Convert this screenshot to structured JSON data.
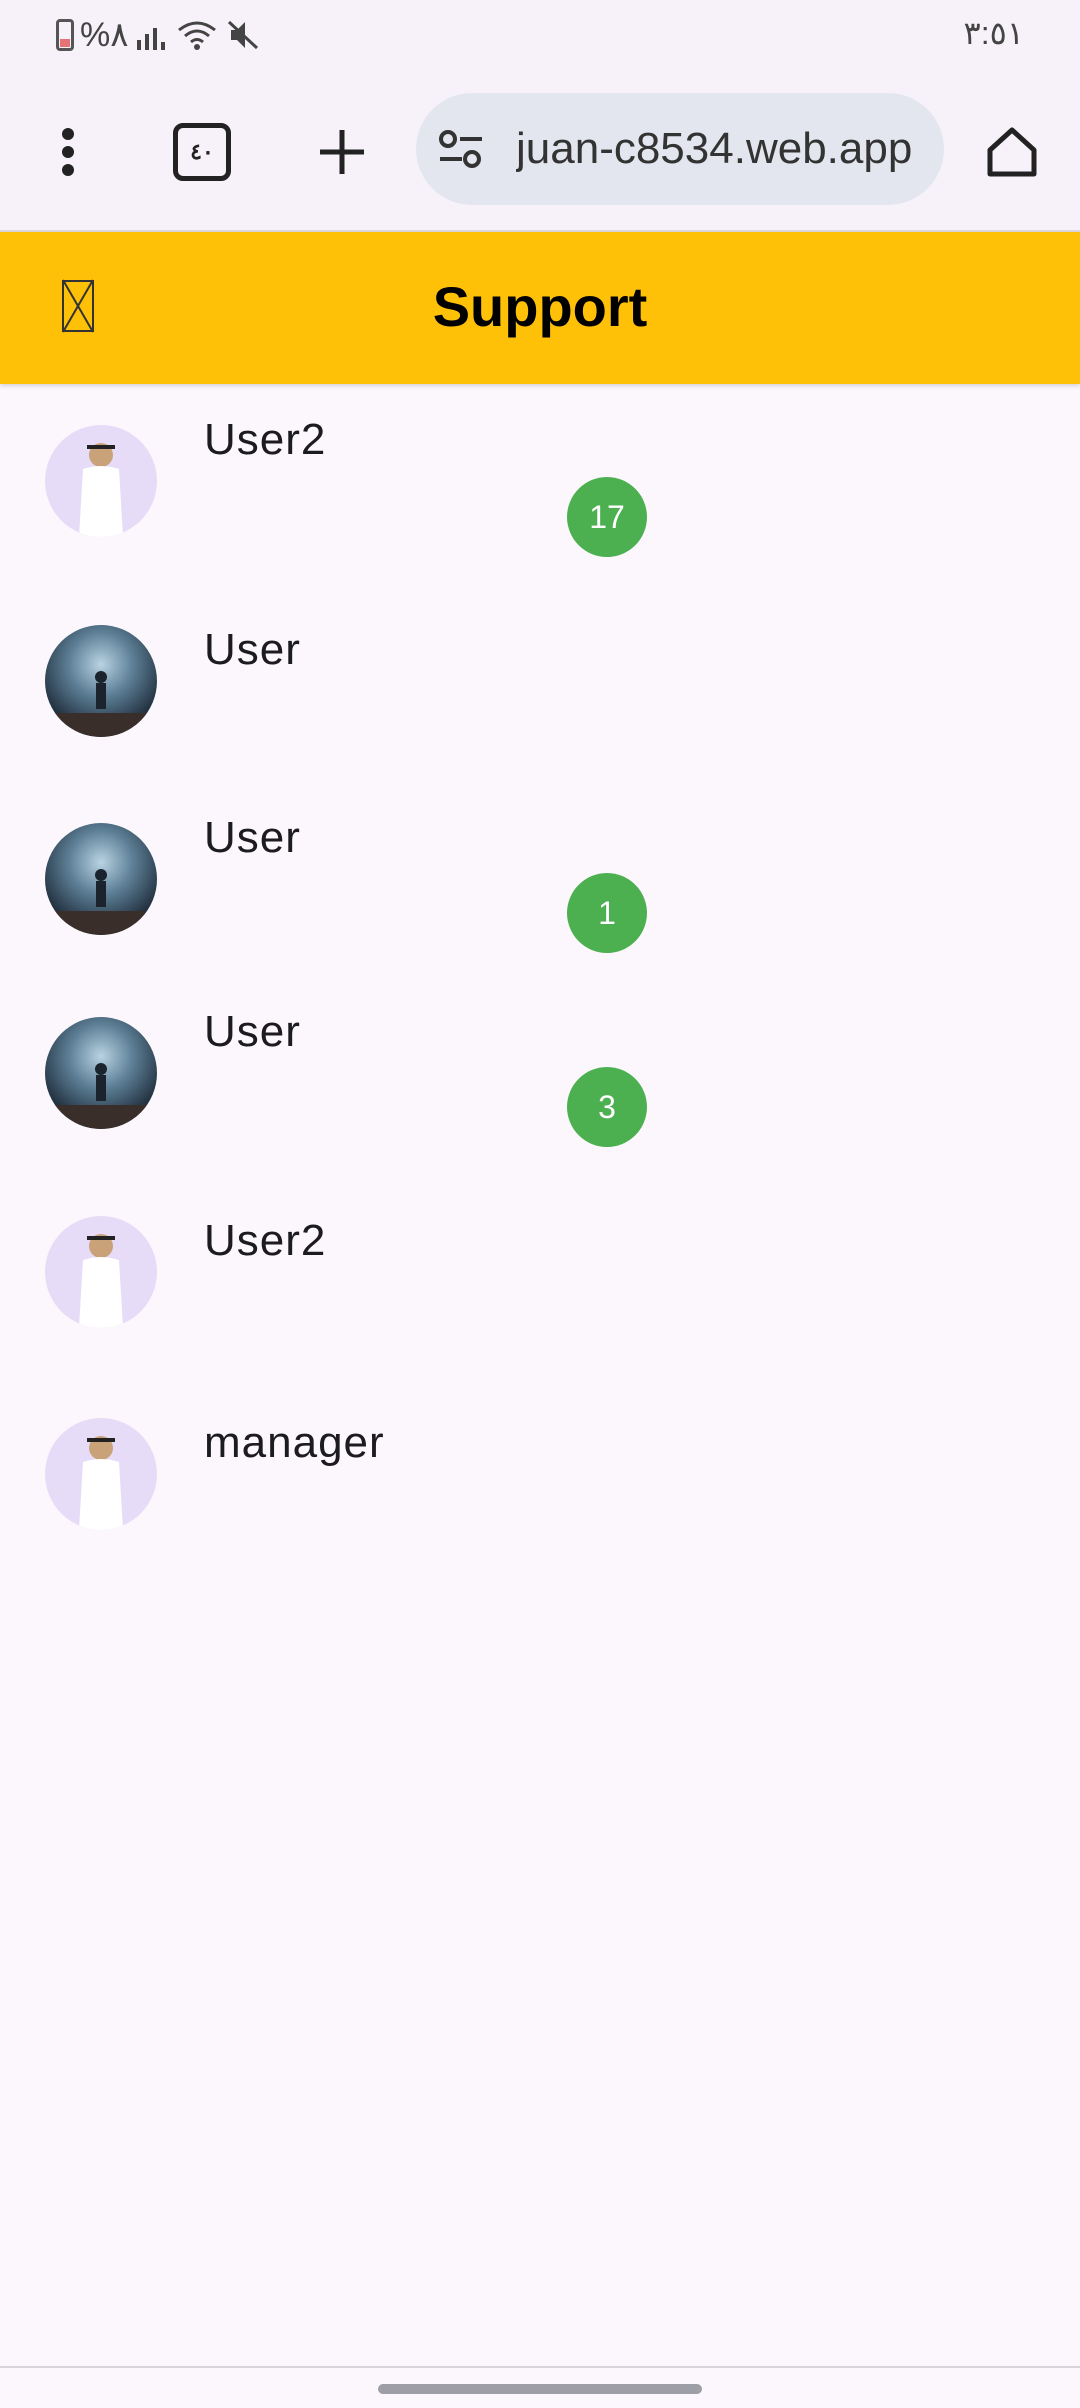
{
  "status_bar": {
    "battery_text": "%٨",
    "time": "٣:٥١"
  },
  "browser": {
    "url": "juan-c8534.web.app",
    "tabs_count": "٤٠"
  },
  "app_bar": {
    "title": "Support"
  },
  "chats": [
    {
      "name": "User2",
      "avatar": "user2-avatar",
      "badge": "17"
    },
    {
      "name": "User",
      "avatar": "user-avatar",
      "badge": ""
    },
    {
      "name": "User",
      "avatar": "user-avatar",
      "badge": "1"
    },
    {
      "name": "User",
      "avatar": "user-avatar",
      "badge": "3"
    },
    {
      "name": "User2",
      "avatar": "user2-avatar",
      "badge": ""
    },
    {
      "name": "manager",
      "avatar": "user2-avatar",
      "badge": ""
    }
  ],
  "colors": {
    "app_bar": "#ffc107",
    "badge": "#4caf50",
    "background": "#fcf7fc"
  }
}
